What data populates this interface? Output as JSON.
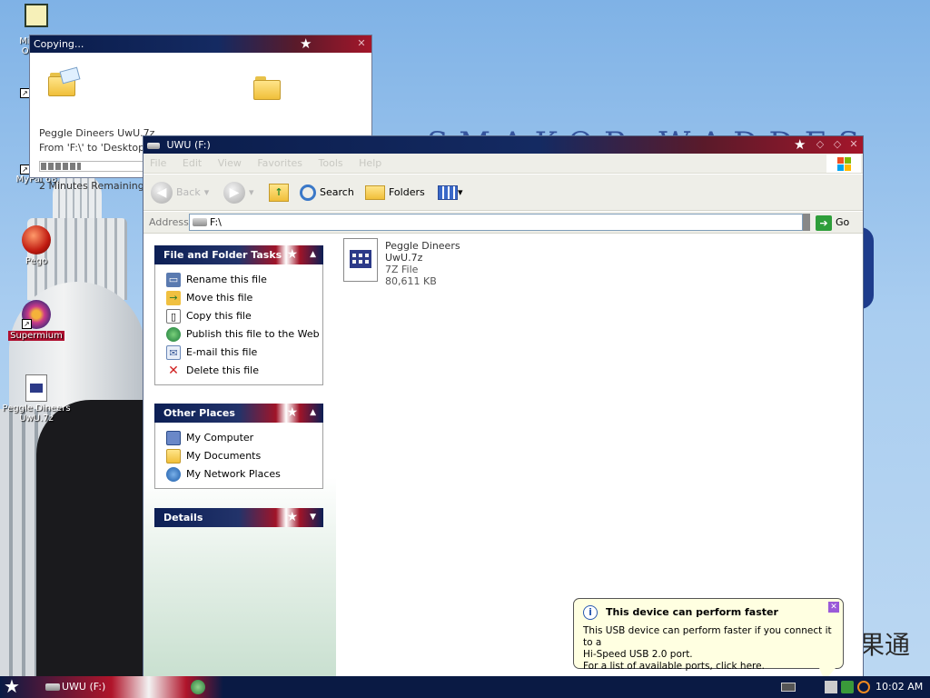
{
  "desktop": {
    "icons": [
      {
        "label": "Mic\nOu",
        "name": "outlook"
      },
      {
        "label": "",
        "name": "shortcut-2"
      },
      {
        "label": "MyPal 68",
        "name": "mypal"
      },
      {
        "label": "Pego",
        "name": "pego"
      },
      {
        "label": "Supermium",
        "name": "supermium"
      },
      {
        "label": "Peggle Dineers\nUwU.7z",
        "name": "peggle-archive"
      }
    ],
    "background_text": "SMAKOR WADDES",
    "corner_text": "果通"
  },
  "copy_dialog": {
    "title": "Copying...",
    "file_name": "Peggle Dineers UwU.7z",
    "from_to": "From 'F:\\' to 'Desktop'",
    "remaining": "2 Minutes Remaining",
    "progress": 0.14
  },
  "explorer": {
    "title": "UWU (F:)",
    "menu": [
      "File",
      "Edit",
      "View",
      "Favorites",
      "Tools",
      "Help"
    ],
    "toolbar": {
      "back_label": "Back",
      "search_label": "Search",
      "folders_label": "Folders"
    },
    "address": {
      "label": "Address",
      "value": "F:\\",
      "go_label": "Go"
    },
    "panels": {
      "file_tasks": {
        "title": "File and Folder Tasks",
        "items": [
          {
            "label": "Rename this file",
            "icon": "rename-icon"
          },
          {
            "label": "Move this file",
            "icon": "move-icon"
          },
          {
            "label": "Copy this file",
            "icon": "copy-icon"
          },
          {
            "label": "Publish this file to the Web",
            "icon": "globe-icon"
          },
          {
            "label": "E-mail this file",
            "icon": "email-icon"
          },
          {
            "label": "Delete this file",
            "icon": "delete-icon"
          }
        ]
      },
      "other_places": {
        "title": "Other Places",
        "items": [
          {
            "label": "My Computer",
            "icon": "computer-icon"
          },
          {
            "label": "My Documents",
            "icon": "documents-icon"
          },
          {
            "label": "My Network Places",
            "icon": "network-icon"
          }
        ]
      },
      "details": {
        "title": "Details"
      }
    },
    "file": {
      "name": "Peggle Dineers UwU.7z",
      "type": "7Z File",
      "size": "80,611 KB"
    }
  },
  "balloon": {
    "title": "This device can perform faster",
    "line1": "This USB device can perform faster if you connect it to a",
    "line2": "Hi-Speed USB 2.0 port.",
    "line3": "For a list of available ports, click here."
  },
  "taskbar": {
    "task_label": "UWU (F:)",
    "clock": "10:02 AM"
  },
  "colors": {
    "title_navy": "#0a1c4a",
    "title_red": "#a4162a",
    "balloon_bg": "#ffffe1"
  }
}
